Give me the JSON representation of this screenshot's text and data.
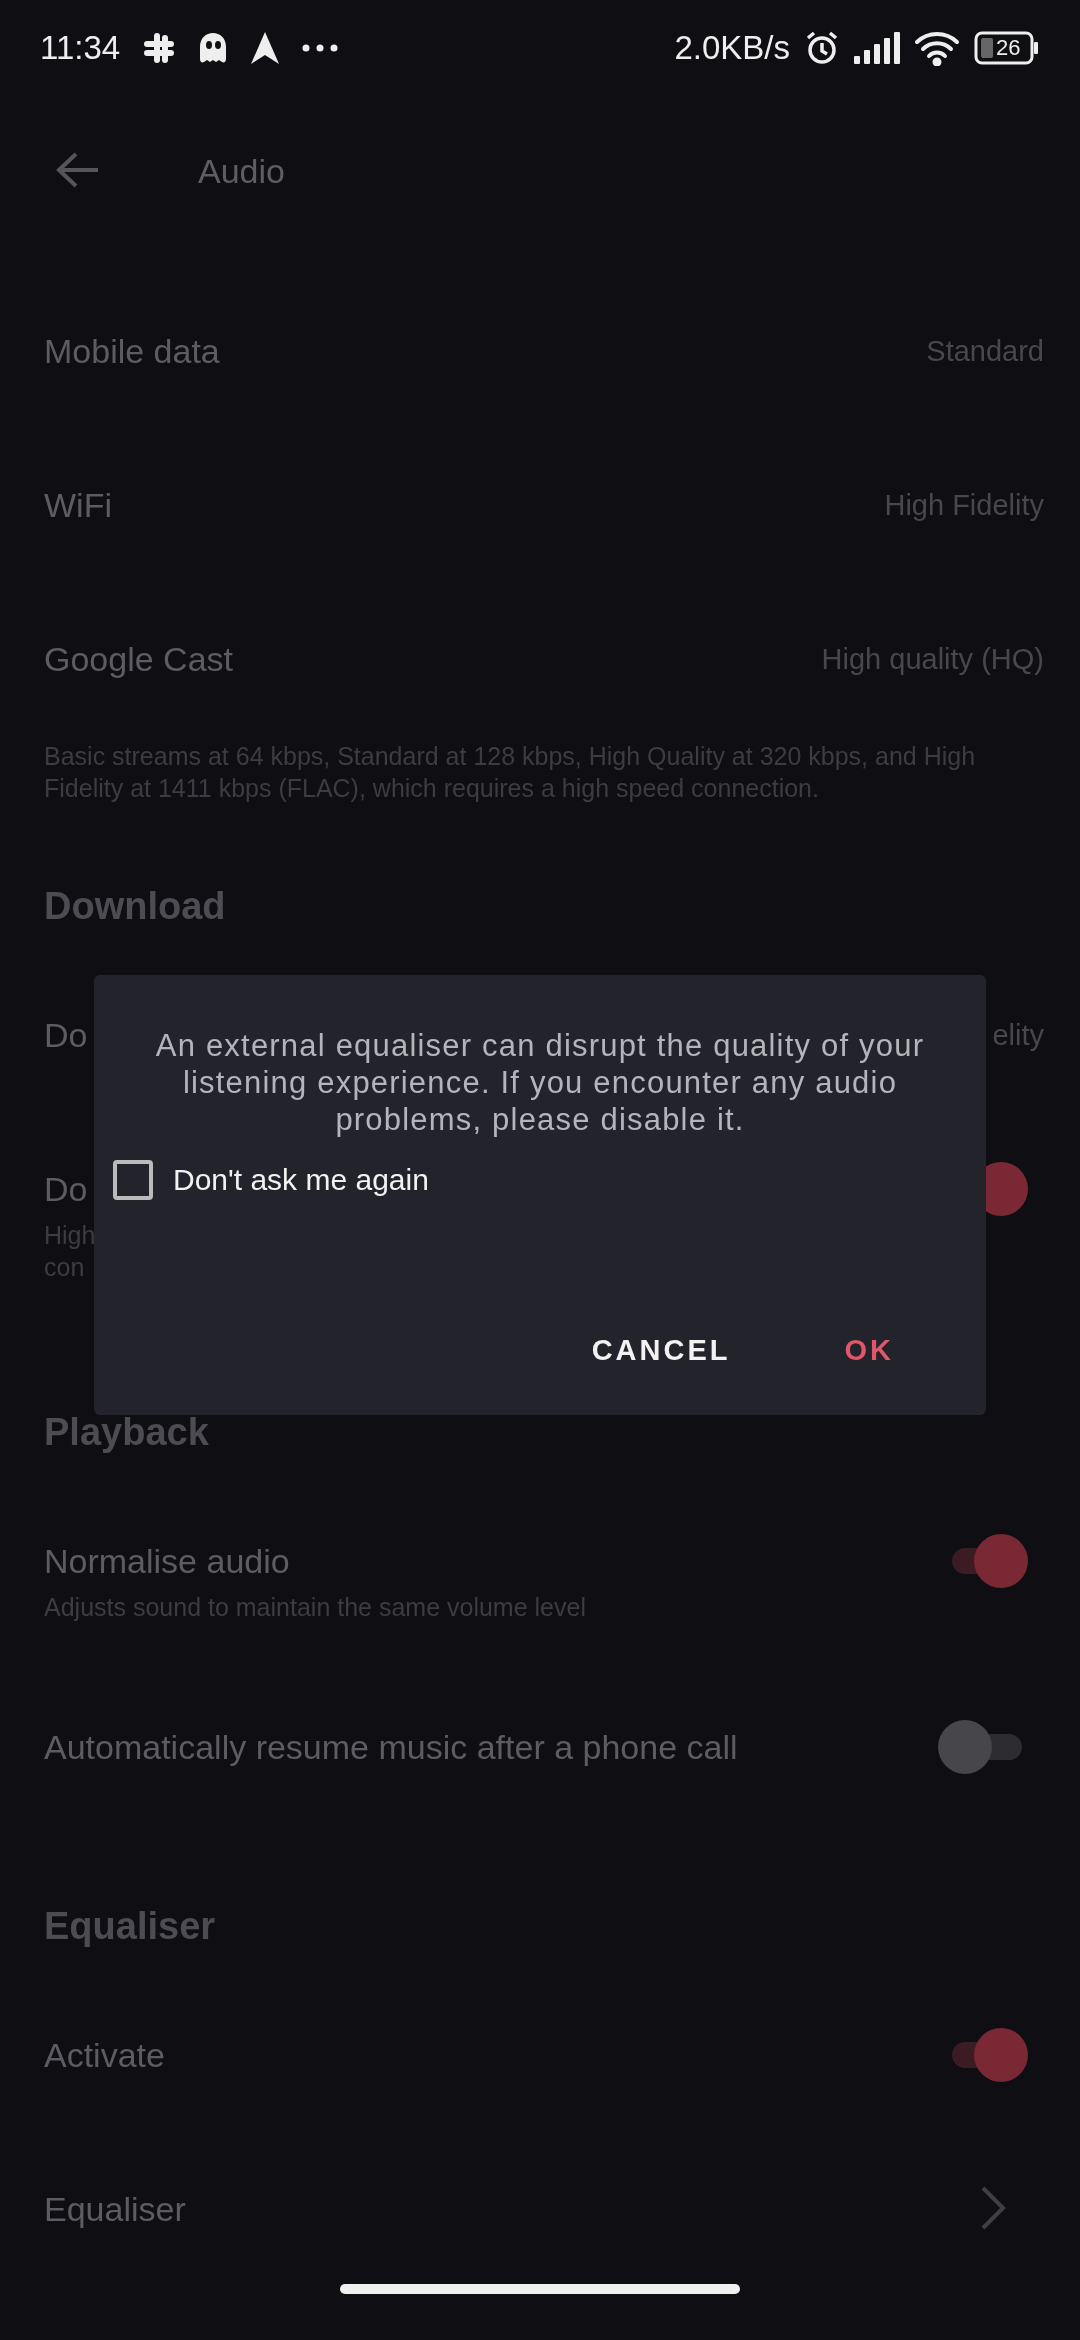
{
  "status_bar": {
    "time": "11:34",
    "network_speed": "2.0KB/s",
    "battery": "26"
  },
  "top_bar": {
    "title": "Audio"
  },
  "items": [
    {
      "kind": "value",
      "label": "Mobile data",
      "value": "Standard"
    },
    {
      "kind": "value",
      "label": "WiFi",
      "value": "High Fidelity"
    },
    {
      "kind": "value",
      "label": "Google Cast",
      "value": "High quality (HQ)"
    },
    {
      "kind": "description",
      "text": "Basic streams at 64 kbps, Standard at 128 kbps, High Quality at 320 kbps, and High Fidelity at 1411 kbps (FLAC), which requires a high speed connection."
    },
    {
      "kind": "header",
      "text": "Download"
    },
    {
      "kind": "value",
      "label": "Do",
      "value": "elity"
    },
    {
      "kind": "toggle",
      "label": "Do",
      "on": true,
      "description": "High\ncon"
    },
    {
      "kind": "header",
      "text": "Playback"
    },
    {
      "kind": "toggle",
      "label": "Normalise audio",
      "on": true,
      "description": "Adjusts sound to maintain the same volume level"
    },
    {
      "kind": "toggle",
      "label": "Automatically resume music after a phone call",
      "on": false
    },
    {
      "kind": "header",
      "text": "Equaliser"
    },
    {
      "kind": "toggle",
      "label": "Activate",
      "on": true
    },
    {
      "kind": "link",
      "label": "Equaliser"
    }
  ],
  "dialog": {
    "message": "An external equaliser can disrupt the quality of your listening experience. If you encounter any audio problems, please disable it.",
    "checkbox": {
      "label": "Don't ask me again",
      "checked": false
    },
    "buttons": [
      {
        "label": "CANCEL",
        "kind": "neutral"
      },
      {
        "label": "OK",
        "kind": "primary"
      }
    ]
  }
}
